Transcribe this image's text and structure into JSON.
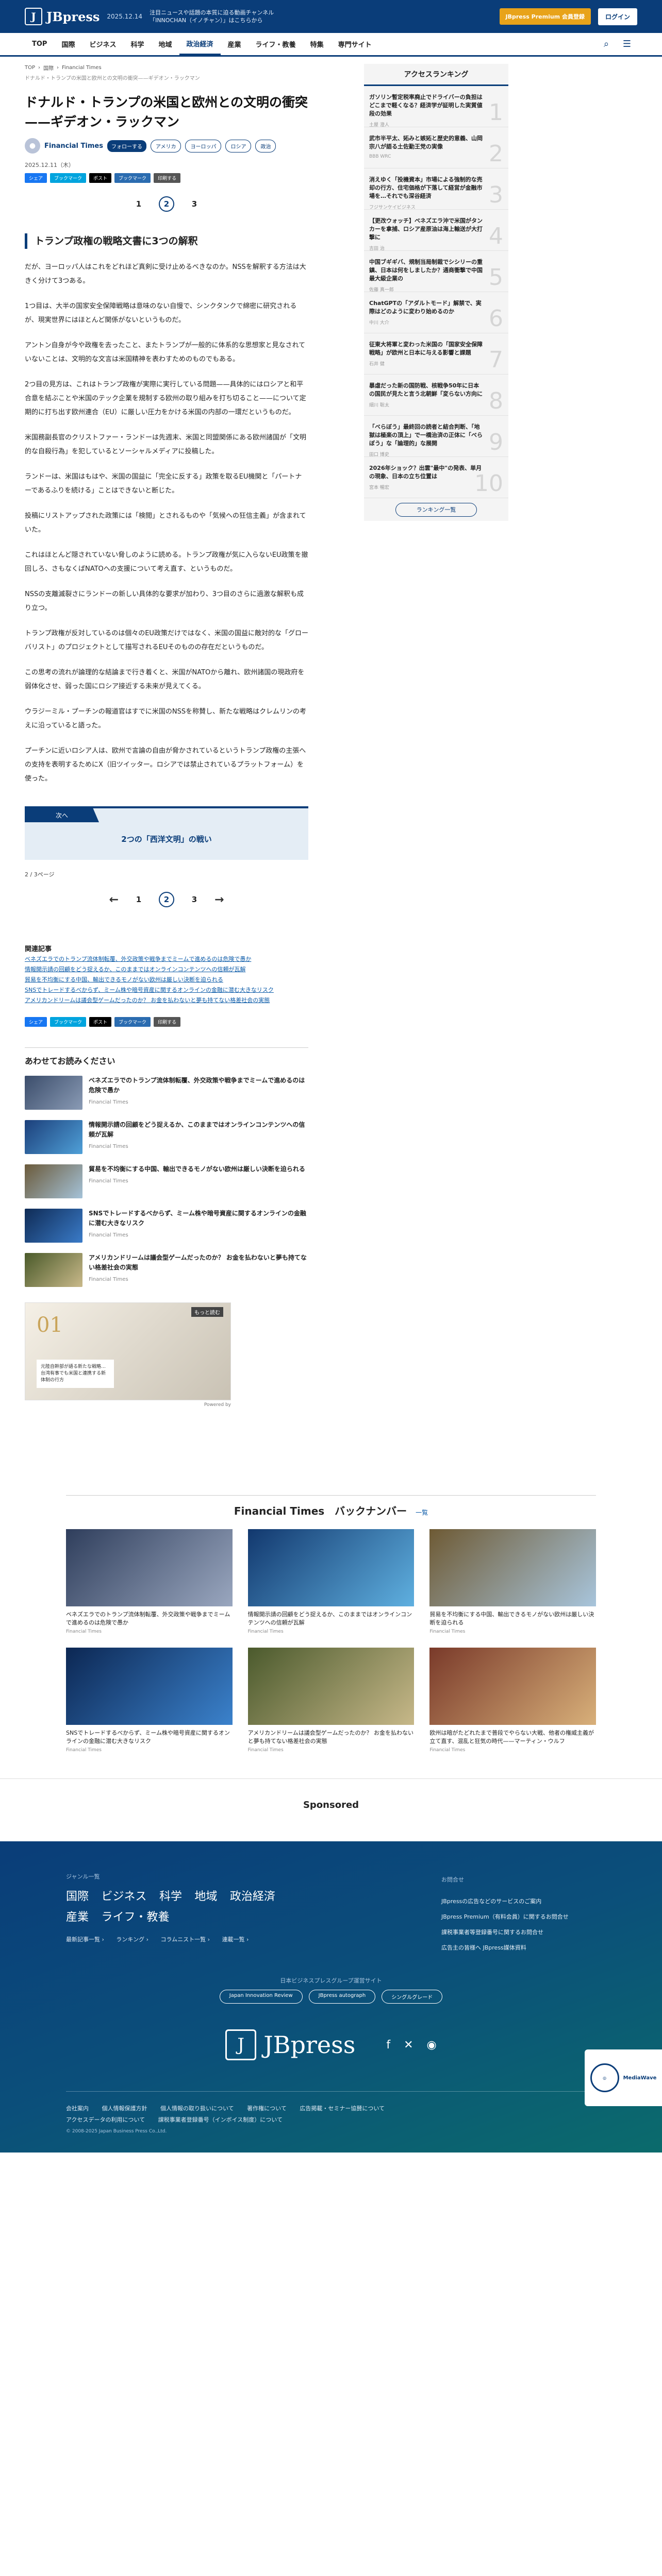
{
  "header": {
    "logo": "JBpress",
    "date": "2025.12.14",
    "news": "注目ニュースや話題の本質に迫る動画チャンネル「INNOCHAN（イノチャン）」はこちらから",
    "premium": "JBpress Premium 会員登録",
    "login": "ログイン"
  },
  "nav": [
    "TOP",
    "国際",
    "ビジネス",
    "科学",
    "地域",
    "政治経済",
    "産業",
    "ライフ・教養",
    "特集",
    "専門サイト"
  ],
  "breadcrumb": [
    "TOP",
    "国際",
    "Financial Times"
  ],
  "breadcrumb_sub": "ドナルド・トランプの米国と欧州との文明の衝突——ギデオン・ラックマン",
  "article": {
    "title": "ドナルド・トランプの米国と欧州との文明の衝突——ギデオン・ラックマン",
    "author": "Financial Times",
    "follow": "フォローする",
    "tags": [
      "アメリカ",
      "ヨーロッパ",
      "ロシア",
      "政治"
    ],
    "date": "2025.12.11（木）",
    "share": [
      "シェア",
      "ブックマーク",
      "ポスト",
      "ブックマーク",
      "印刷する"
    ],
    "section": "トランプ政権の戦略文書に3つの解釈",
    "paragraphs": [
      "だが、ヨーロッパ人はこれをどれほど真剣に受け止めるべきなのか。NSSを解釈する方法は大きく分けて3つある。",
      "1つ目は、大半の国家安全保障戦略は意味のない自慢で、シンクタンクで綿密に研究されるが、現実世界にはほとんど関係がないというものだ。",
      "アントン自身が今や政権を去ったこと、またトランプが一般的に体系的な思想家と見なされていないことは、文明的な文言は米国精神を表わすためのものでもある。",
      "2つ目の見方は、これはトランプ政権が実際に実行している問題——具体的にはロシアと和平合意を結ぶことや米国のテック企業を規制する欧州の取り組みを打ち切ること——について定期的に打ち出す欧州連合（EU）に厳しい圧力をかける米国の内部の一環だというものだ。",
      "米国務副長官のクリストファー・ランドーは先週末、米国と同盟関係にある欧州諸国が「文明的な自殺行為」を犯しているとソーシャルメディアに投稿した。",
      "ランドーは、米国はもはや、米国の国益に「完全に反する」政策を取るEU機関と「パートナーであるふりを続ける」ことはできないと断じた。",
      "投稿にリストアップされた政策には「検閲」とされるものや「気候への狂信主義」が含まれていた。",
      "これはほとんど隠されていない脅しのように読める。トランプ政権が気に入らないEU政策を撤回しろ、さもなくばNATOへの支援について考え直す、というものだ。",
      "NSSの支離滅裂さにランドーの新しい具体的な要求が加わり、3つ目のさらに過激な解釈も成り立つ。",
      "トランプ政権が反対しているのは個々のEU政策だけではなく、米国の国益に敵対的な「グローバリスト」のプロジェクトとして描写されるEUそのものの存在だというものだ。",
      "この思考の流れが論理的な結論まで行き着くと、米国がNATOから離れ、欧州諸国の現政府を弱体化させ、弱った国にロシア接近する未来が見えてくる。",
      "ウラジーミル・プーチンの報道官はすでに米国のNSSを称賛し、新たな戦略はクレムリンの考えに沿っていると語った。",
      "プーチンに近いロシア人は、欧州で言論の自由が脅かされているというトランプ政権の主張への支持を表明するためにX（旧ツイッター。ロシアでは禁止されているプラットフォーム）を使った。"
    ],
    "next_label": "次へ",
    "next_title": "2つの「西洋文明」の戦い",
    "pagecount": "2 / 3ページ",
    "pages": [
      "1",
      "2",
      "3"
    ]
  },
  "related": {
    "title": "関連記事",
    "links": [
      "ベネズエラでのトランプ流体制転覆、外交政策や戦争までミームで進めるのは危険で愚か",
      "情報開示請の回顧をどう捉えるか、このままではオンラインコンテンツへの信頼が瓦解",
      "貿易を不均衡にする中国、輸出できるモノがない欧州は厳しい決断を迫られる",
      "SNSでトレードするべからず、ミーム株や暗号資産に関するオンラインの金融に潜む大きなリスク",
      "アメリカンドリームは議会型ゲームだったのか？ お金を払わないと夢も持てない格差社会の実態"
    ]
  },
  "reading": {
    "title": "あわせてお読みください",
    "items": [
      {
        "title": "ベネズエラでのトランプ流体制転覆、外交政策や戦争までミームで進めるのは危険で愚か",
        "src": "Financial Times"
      },
      {
        "title": "情報開示請の回顧をどう捉えるか、このままではオンラインコンテンツへの信頼が瓦解",
        "src": "Financial Times"
      },
      {
        "title": "貿易を不均衡にする中国、輸出できるモノがない欧州は厳しい決断を迫られる",
        "src": "Financial Times"
      },
      {
        "title": "SNSでトレードするべからず、ミーム株や暗号資産に関するオンラインの金融に潜む大きなリスク",
        "src": "Financial Times"
      },
      {
        "title": "アメリカンドリームは議会型ゲームだったのか？ お金を払わないと夢も持てない格差社会の実態",
        "src": "Financial Times"
      }
    ]
  },
  "ad": {
    "num": "01",
    "tag": "もっと読む",
    "caption": "元陸自幹部が語る新たな戦略…台湾有事でも米国と連携する新体制の行方",
    "powered": "Powered by "
  },
  "ranking": {
    "title": "アクセスランキング",
    "items": [
      {
        "title": "ガソリン暫定税率廃止でドライバーの負担はどこまで軽くなる？経済学が証明した実質値段の効果",
        "src": "土屋 澄人"
      },
      {
        "title": "武市半平太、妬みと嫉妬と歴史的意義、山岡宗八が語る土佐勤王党の実像",
        "src": "BBB WRC"
      },
      {
        "title": "消えゆく「投機資本」市場による強制的な売却の行方、住宅価格が下落して経営が金融市場を…それでも深谷経済",
        "src": "フジサンケイビジネス"
      },
      {
        "title": "【更改ウォッチ】ベネズエラ沖で米国がタンカーを拿捕、ロシア産原油は海上輸送が大打撃に",
        "src": "吉田 治"
      },
      {
        "title": "中国ブギギバ、規制当局制裁でシシリーの重鎮、日本は何をしましたか？通商衝撃で中国最大級企業の",
        "src": "佐藤 真一郎"
      },
      {
        "title": "ChatGPTの「アダルトモード」解禁で、実際はどのように変わり始めるのか",
        "src": "中川 大介"
      },
      {
        "title": "征東大将軍と変わった米国の「国家安全保障戦略」が欧州と日本に与える影響と課題",
        "src": "石井 健"
      },
      {
        "title": "暴虐だった新の国防戦、核戦争50年に日本の国民が見たと言う北朝鮮「変らない方向に",
        "src": "細川 聡太"
      },
      {
        "title": "「べらぼう」最終回の読者と結合判断、「地獄は極楽の頂上」で一橋治済の正体に「べらぼう」な「論理的」な展開",
        "src": "田口 博史"
      },
      {
        "title": "2026年ショック？出雲\"最中\"の発表、単月の現象、日本の立ち位置は",
        "src": "宮本 暢宏"
      }
    ],
    "more": "ランキング一覧"
  },
  "backnumber": {
    "title": "Financial Times　バックナンバー",
    "more": "一覧",
    "items": [
      {
        "title": "ベネズエラでのトランプ流体制転覆、外交政策や戦争までミームで進めるのは危険で愚か",
        "src": "Financial Times"
      },
      {
        "title": "情報開示請の回顧をどう捉えるか、このままではオンラインコンテンツへの信頼が瓦解",
        "src": "Financial Times"
      },
      {
        "title": "貿易を不均衡にする中国、輸出できるモノがない欧州は厳しい決断を迫られる",
        "src": "Financial Times"
      },
      {
        "title": "SNSでトレードするべからず、ミーム株や暗号資産に関するオンラインの金融に潜む大きなリスク",
        "src": "Financial Times"
      },
      {
        "title": "アメリカンドリームは議会型ゲームだったのか？ お金を払わないと夢も持てない格差社会の実態",
        "src": "Financial Times"
      },
      {
        "title": "欧州は暗がたどれたまで普段でやらない大戦、他者の権威主義が立て直す、混乱と狂気の時代——マーティン・ウルフ",
        "src": "Financial Times"
      }
    ]
  },
  "sponsored": "Sponsored",
  "footer": {
    "genre_label": "ジャンル一覧",
    "genres": [
      "国際",
      "ビジネス",
      "科学",
      "地域",
      "政治経済",
      "産業",
      "ライフ・教養"
    ],
    "links": [
      "最新記事一覧 ›",
      "ランキング ›",
      "コラムニスト一覧 ›",
      "連載一覧 ›"
    ],
    "right_label": "お問合せ",
    "right": [
      "JBpressの広告などのサービスのご案内",
      "JBpress Premium（有料会員）に関するお問合せ",
      "課税事業者等登録番号に関するお問合せ",
      "広告主の皆様へ JBpress媒体資料"
    ],
    "group_label": "日本ビジネスプレスグループ運営サイト",
    "group": [
      "Japan Innovation Review",
      "JBpress autograph",
      "シングルグレード"
    ],
    "logo": "JBpress",
    "bottom": [
      "会社案内",
      "個人情報保護方針",
      "個人情報の取り扱いについて",
      "著作権について",
      "広告掲載・セミナー協賛について",
      "アクセスデータの利用について",
      "課税事業者登録番号（インボイス制度）について"
    ],
    "copy": "© 2008-2025 Japan Business Press Co.,Ltd.",
    "badge": "MediaWave"
  }
}
